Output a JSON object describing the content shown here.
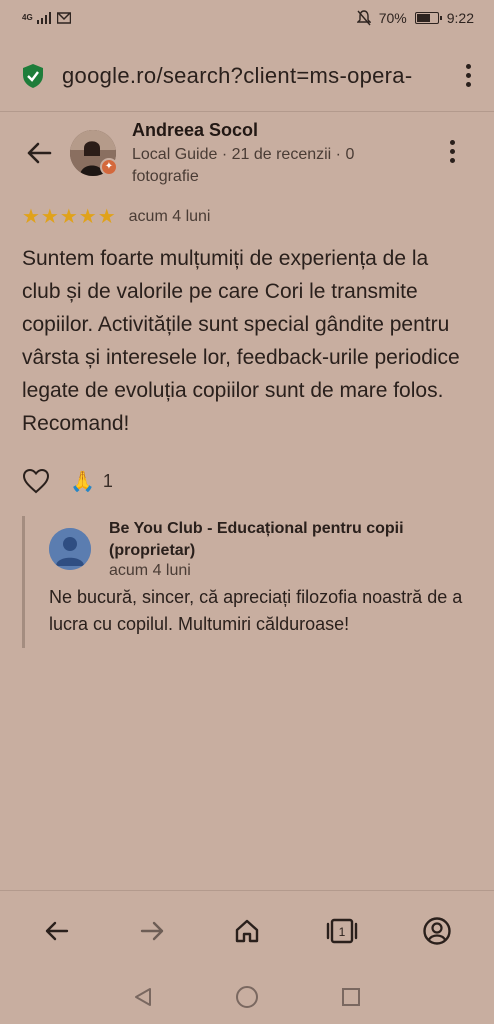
{
  "status_bar": {
    "network": "4G",
    "battery_percent": "70%",
    "battery_level": 0.7,
    "time": "9:22"
  },
  "browser": {
    "url": "google.ro/search?client=ms-opera-",
    "secure_icon": "shield-check-icon"
  },
  "review": {
    "reviewer_name": "Andreea Socol",
    "reviewer_meta": "Local Guide · 21 de recenzii · 0 fotografie",
    "rating": 5,
    "stars_text": "★★★★★",
    "time": "acum 4 luni",
    "text": "Suntem foarte mulțumiți de experiența de la club și de valorile pe care Cori le transmite copiilor. Activitățile sunt special gândite pentru vârsta și interesele lor, feedback-urile periodice legate de evoluția copiilor sunt de mare folos. Recomand!",
    "reaction_emoji": "🙏",
    "reaction_count": "1"
  },
  "owner_reply": {
    "name": "Be You Club - Educațional pentru copii (proprietar)",
    "time": "acum 4 luni",
    "text": "Ne bucură, sincer, că apreciați filozofia noastră de a lucra cu copilul. Multumiri călduroase!"
  },
  "toolbar": {
    "tab_count": "1"
  },
  "colors": {
    "background": "#c8aea0",
    "stars": "#e0a21a",
    "secure": "#1e7d3a",
    "owner_avatar": "#5b7db0"
  }
}
